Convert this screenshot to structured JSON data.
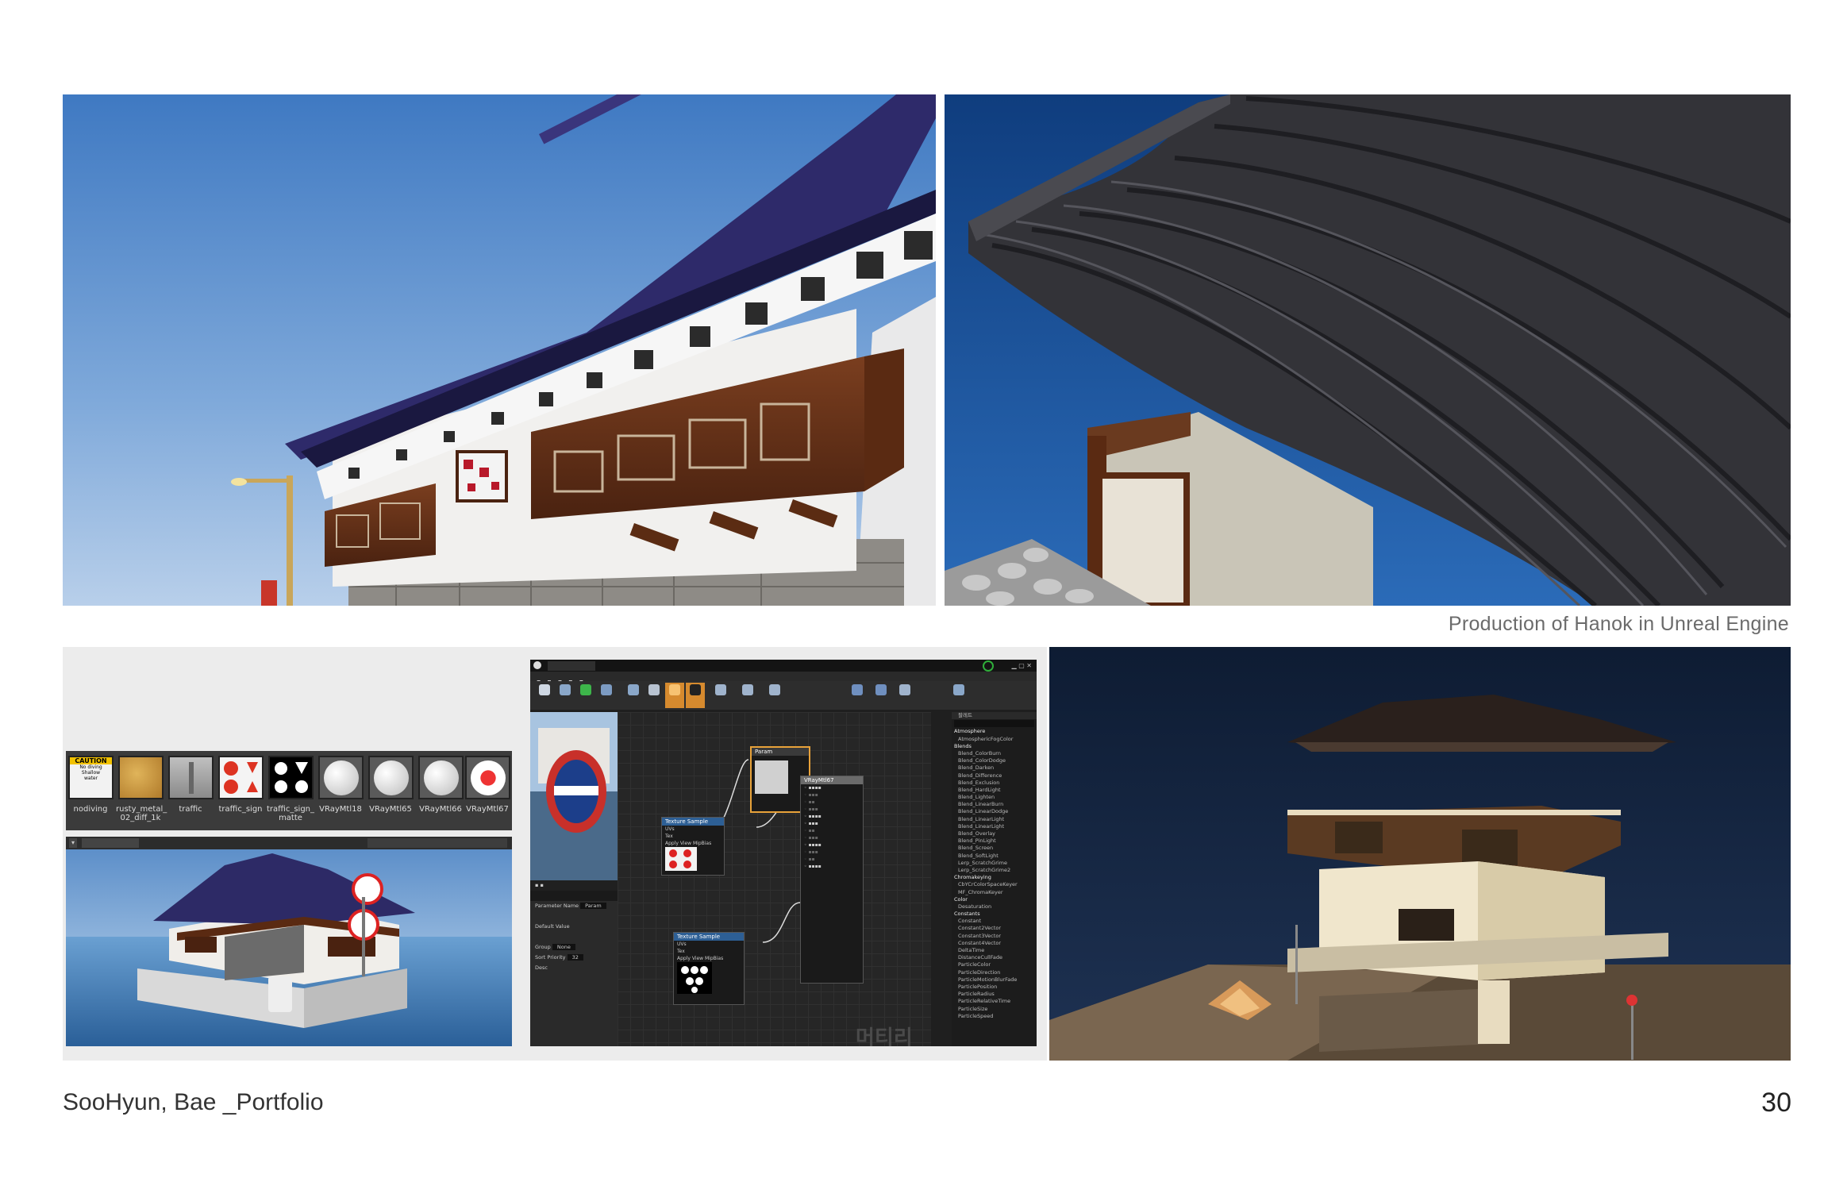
{
  "caption": "Production of Hanok in Unreal Engine",
  "footer": {
    "author": "SooHyun, Bae _Portfolio",
    "page_number": "30"
  },
  "materials": [
    {
      "label": "nodiving",
      "icon": "caution-sign-icon"
    },
    {
      "label": "rusty_metal_\n02_diff_1k",
      "icon": "rust-texture-icon"
    },
    {
      "label": "traffic",
      "icon": "metal-pole-icon"
    },
    {
      "label": "traffic_sign",
      "icon": "traffic-signs-icon"
    },
    {
      "label": "traffic_sign_\nmatte",
      "icon": "white-shapes-icon"
    },
    {
      "label": "VRayMtl18",
      "icon": "white-sphere-icon"
    },
    {
      "label": "VRayMtl65",
      "icon": "white-sphere-icon"
    },
    {
      "label": "VRayMtl66",
      "icon": "white-sphere-icon"
    },
    {
      "label": "VRayMtl67",
      "icon": "sign-sphere-icon"
    }
  ],
  "material_strip_text": {
    "caution_title": "CAUTION",
    "caution_body": "No diving\nShallow\nwater"
  },
  "editor": {
    "nodes": {
      "param": "Param",
      "main": "VRayMtl67",
      "tex1": "Texture Sample",
      "tex2": "Texture Sample"
    },
    "tex_rows": [
      "UVs",
      "Tex",
      "Apply View MipBias"
    ],
    "tex_pins": [
      "RGB",
      "R",
      "G",
      "B",
      "A",
      "RGBA"
    ],
    "details_rows": [
      "Parameter Name",
      "Group",
      "Sort Priority",
      "Desc",
      "Default Value"
    ],
    "details_values": {
      "parameter_name": "Param",
      "group": "None",
      "sort_priority": "32"
    },
    "watermark": "머티리얼",
    "palette_header": "팔레트",
    "palette_categories": [
      {
        "head": "Atmosphere",
        "items": [
          "AtmosphericFogColor"
        ]
      },
      {
        "head": "Blends",
        "items": [
          "Blend_ColorBurn",
          "Blend_ColorDodge",
          "Blend_Darken",
          "Blend_Difference",
          "Blend_Exclusion",
          "Blend_HardLight",
          "Blend_Lighten",
          "Blend_LinearBurn",
          "Blend_LinearDodge",
          "Blend_LinearLight",
          "Blend_LinearLight",
          "Blend_Overlay",
          "Blend_PinLight",
          "Blend_Screen",
          "Blend_SoftLight",
          "Lerp_ScratchGrime",
          "Lerp_ScratchGrime2"
        ]
      },
      {
        "head": "Chromakeying",
        "items": [
          "CbYCrColorSpaceKeyer",
          "MF_ChromaKeyer"
        ]
      },
      {
        "head": "Color",
        "items": [
          "Desaturation"
        ]
      },
      {
        "head": "Constants",
        "items": [
          "Constant",
          "Constant2Vector",
          "Constant3Vector",
          "Constant4Vector",
          "DeltaTime",
          "DistanceCullFade",
          "ParticleColor",
          "ParticleDirection",
          "ParticleMotionBlurFade",
          "ParticlePosition",
          "ParticleRadius",
          "ParticleRelativeTime",
          "ParticleSize",
          "ParticleSpeed"
        ]
      }
    ]
  }
}
